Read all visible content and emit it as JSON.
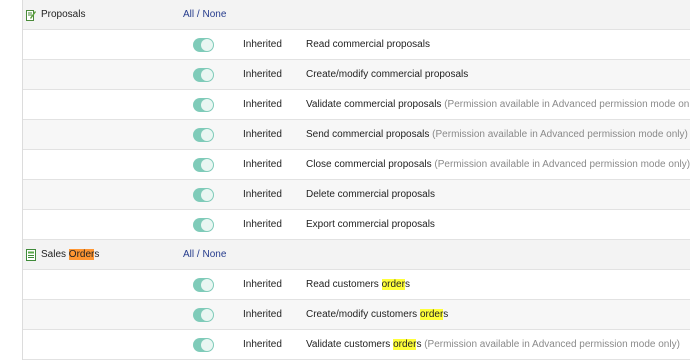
{
  "modules": [
    {
      "name_parts": [
        "Proposals"
      ],
      "all_label": "All",
      "sep": " / ",
      "none_label": "None",
      "icon": "proposal-edit-icon",
      "permissions": [
        {
          "status": "Inherited",
          "label_parts": [
            "Read commercial proposals"
          ],
          "note": ""
        },
        {
          "status": "Inherited",
          "label_parts": [
            "Create/modify commercial proposals"
          ],
          "note": ""
        },
        {
          "status": "Inherited",
          "label_parts": [
            "Validate commercial proposals"
          ],
          "note": "(Permission available in Advanced permission mode only)"
        },
        {
          "status": "Inherited",
          "label_parts": [
            "Send commercial proposals"
          ],
          "note": "(Permission available in Advanced permission mode only)"
        },
        {
          "status": "Inherited",
          "label_parts": [
            "Close commercial proposals"
          ],
          "note": "(Permission available in Advanced permission mode only)"
        },
        {
          "status": "Inherited",
          "label_parts": [
            "Delete commercial proposals"
          ],
          "note": ""
        },
        {
          "status": "Inherited",
          "label_parts": [
            "Export commercial proposals"
          ],
          "note": ""
        }
      ]
    },
    {
      "name_parts": [
        "Sales ",
        "Order",
        "s"
      ],
      "all_label": "All",
      "sep": " / ",
      "none_label": "None",
      "icon": "sales-order-icon",
      "permissions": [
        {
          "status": "Inherited",
          "label_parts": [
            "Read customers ",
            "order",
            "s"
          ],
          "note": ""
        },
        {
          "status": "Inherited",
          "label_parts": [
            "Create/modify customers ",
            "order",
            "s"
          ],
          "note": ""
        },
        {
          "status": "Inherited",
          "label_parts": [
            "Validate customers ",
            "order",
            "s"
          ],
          "note": "(Permission available in Advanced permission mode only)"
        }
      ]
    }
  ],
  "colors": {
    "toggle_on": "#7fcbb9",
    "link": "#263c8d",
    "search_highlight_current": "#ff9632",
    "search_highlight": "#ffff3a",
    "note": "#8a8a8a"
  }
}
